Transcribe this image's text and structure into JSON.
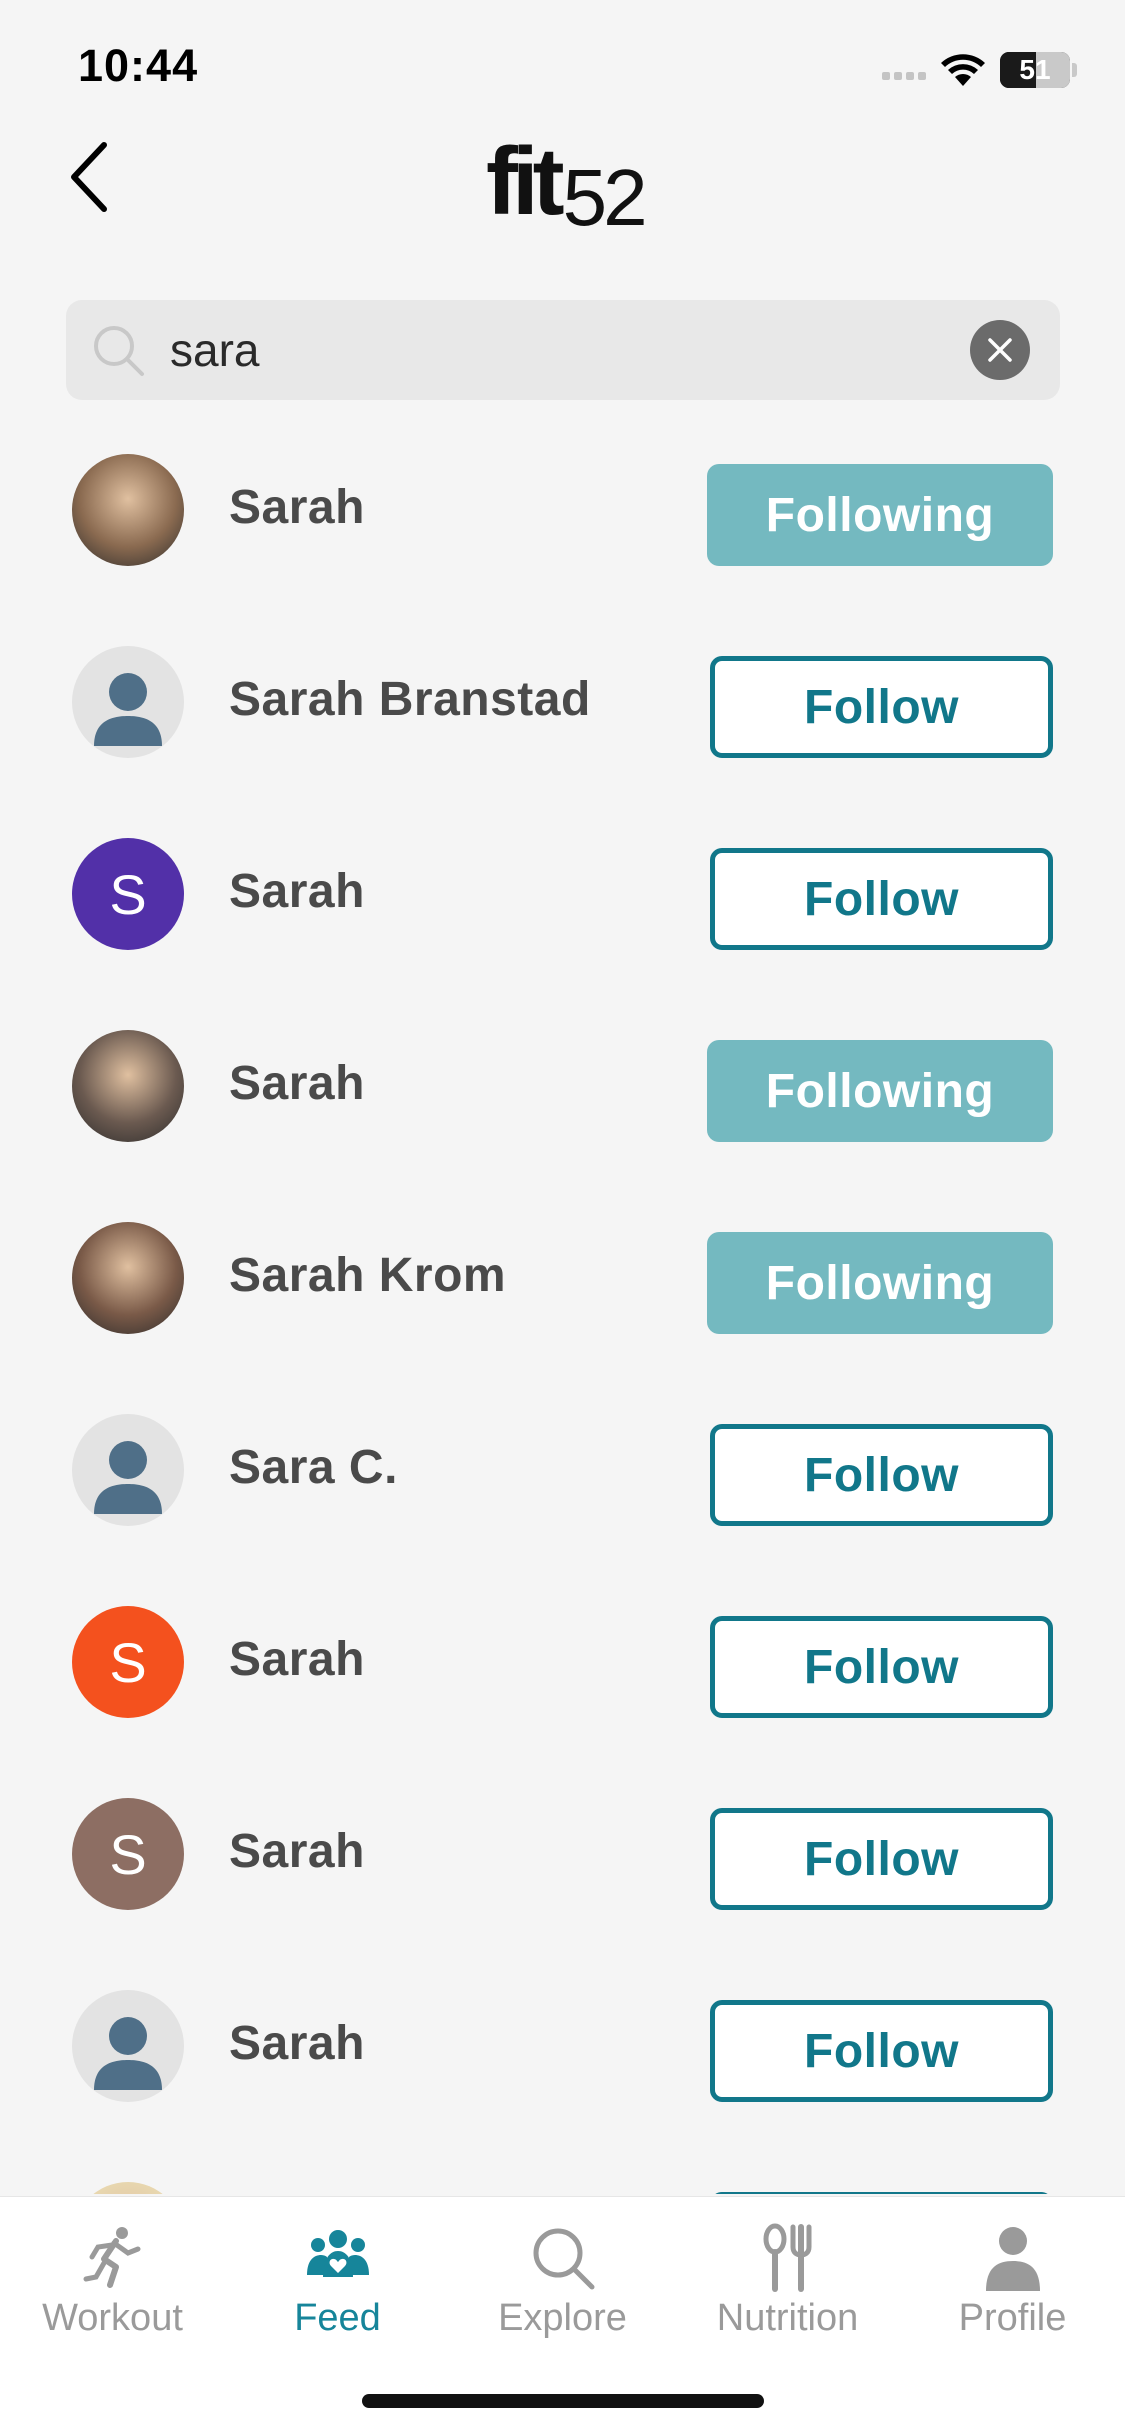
{
  "status_bar": {
    "time": "10:44",
    "battery": "51",
    "battery_level": 0.51
  },
  "app": {
    "logo_text": "fit",
    "logo_number": "52"
  },
  "search": {
    "value": "sara",
    "placeholder": "Search"
  },
  "results": [
    {
      "name": "Sarah",
      "button": "Following",
      "state": "following",
      "avatar": {
        "type": "photo",
        "bg": "#8a6a50"
      }
    },
    {
      "name": "Sarah Branstad",
      "button": "Follow",
      "state": "follow",
      "avatar": {
        "type": "placeholder"
      }
    },
    {
      "name": "Sarah",
      "button": "Follow",
      "state": "follow",
      "avatar": {
        "type": "letter",
        "letter": "S",
        "bg": "#5230a8"
      }
    },
    {
      "name": "Sarah",
      "button": "Following",
      "state": "following",
      "avatar": {
        "type": "photo",
        "bg": "#6b5a50"
      }
    },
    {
      "name": "Sarah Krom",
      "button": "Following",
      "state": "following",
      "avatar": {
        "type": "photo",
        "bg": "#7a5a48"
      }
    },
    {
      "name": "Sara C.",
      "button": "Follow",
      "state": "follow",
      "avatar": {
        "type": "placeholder"
      }
    },
    {
      "name": "Sarah",
      "button": "Follow",
      "state": "follow",
      "avatar": {
        "type": "letter",
        "letter": "S",
        "bg": "#f4511e"
      }
    },
    {
      "name": "Sarah",
      "button": "Follow",
      "state": "follow",
      "avatar": {
        "type": "letter",
        "letter": "S",
        "bg": "#8d6e63"
      }
    },
    {
      "name": "Sarah",
      "button": "Follow",
      "state": "follow",
      "avatar": {
        "type": "placeholder"
      }
    },
    {
      "name": "",
      "button": "",
      "state": "follow",
      "avatar": {
        "type": "photo",
        "bg": "#e8d8b0"
      }
    }
  ],
  "tabs": [
    {
      "label": "Workout",
      "icon": "running-icon",
      "active": false
    },
    {
      "label": "Feed",
      "icon": "community-icon",
      "active": true
    },
    {
      "label": "Explore",
      "icon": "search-icon",
      "active": false
    },
    {
      "label": "Nutrition",
      "icon": "fork-spoon-icon",
      "active": false
    },
    {
      "label": "Profile",
      "icon": "person-icon",
      "active": false
    }
  ],
  "colors": {
    "accent": "#11778a",
    "following_bg": "#74b9c0",
    "tab_active": "#16859a",
    "tab_inactive": "#9a9a9a"
  }
}
